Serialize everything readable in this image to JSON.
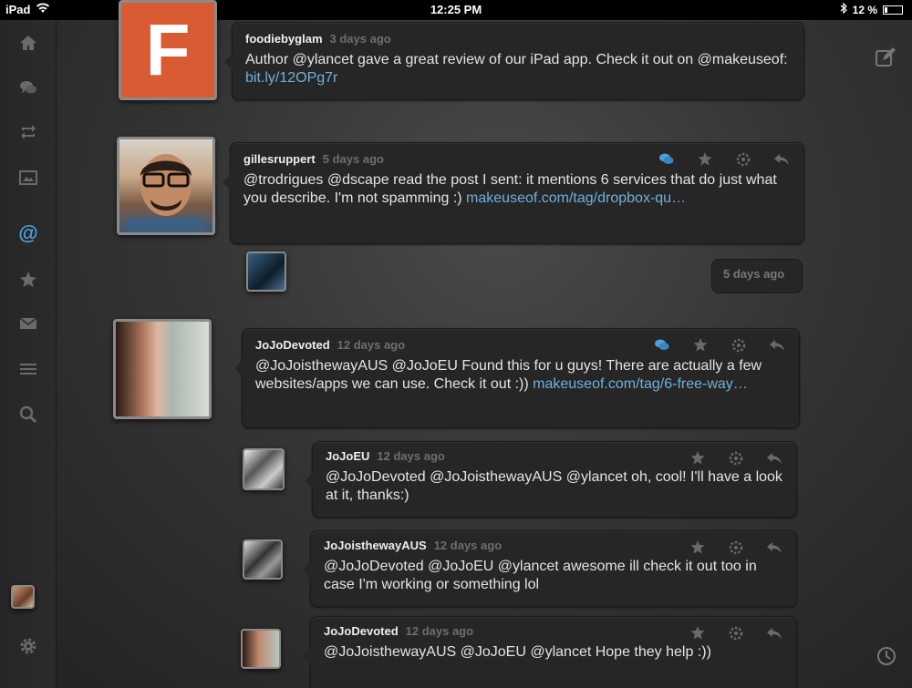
{
  "status_bar": {
    "device": "iPad",
    "time": "12:25 PM",
    "battery": "12 %"
  },
  "colors": {
    "accent": "#4aa3df",
    "link": "#6fb0dc"
  },
  "sidebar": {
    "items": [
      {
        "icon": "home-icon"
      },
      {
        "icon": "messages-icon"
      },
      {
        "icon": "retweet-icon"
      },
      {
        "icon": "media-icon"
      },
      {
        "icon": "mentions-icon",
        "label": "@"
      },
      {
        "icon": "star-icon"
      },
      {
        "icon": "mail-icon"
      },
      {
        "icon": "list-icon"
      },
      {
        "icon": "search-icon"
      },
      {
        "icon": "gear-icon"
      }
    ]
  },
  "tweets": [
    {
      "handle": "foodiebyglam",
      "time": "3 days ago",
      "text": "Author @ylancet gave a great review of our iPad app. Check it out on @makeuseof:",
      "link": "bit.ly/12OPg7r"
    },
    {
      "handle": "gillesruppert",
      "time": "5 days ago",
      "text": "@trodrigues @dscape read the post I sent: it mentions 6 services that do just what you describe. I'm not spamming :)",
      "link": "makeuseof.com/tag/dropbox-qu…"
    },
    {
      "time": "5 days ago"
    },
    {
      "handle": "JoJoDevoted",
      "time": "12 days ago",
      "text": "@JoJoisthewayAUS @JoJoEU Found this for u guys! There are actually a few websites/apps we can use. Check it out :))",
      "link": "makeuseof.com/tag/6-free-way…"
    },
    {
      "handle": "JoJoEU",
      "time": "12 days ago",
      "text": "@JoJoDevoted @JoJoisthewayAUS @ylancet oh, cool! I'll have a look at it, thanks:)"
    },
    {
      "handle": "JoJoisthewayAUS",
      "time": "12 days ago",
      "text": "@JoJoDevoted @JoJoEU @ylancet awesome ill check it out too in case I'm working or something lol"
    },
    {
      "handle": "JoJoDevoted",
      "time": "12 days ago",
      "text": "@JoJoisthewayAUS @JoJoEU @ylancet Hope they help :))"
    }
  ],
  "avatars": {
    "foodiebyglam_letter": "F"
  }
}
